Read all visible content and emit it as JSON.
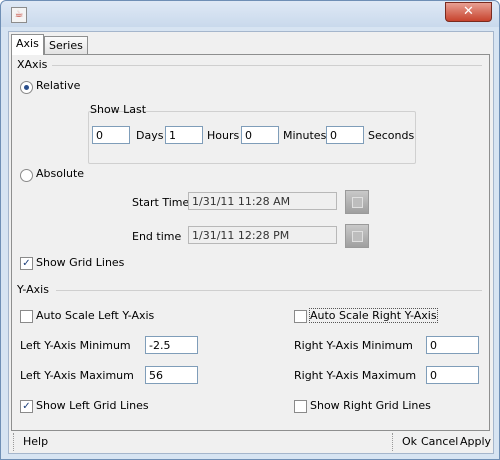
{
  "window": {
    "close_label": "✕"
  },
  "tabs": [
    {
      "label": "Axis"
    },
    {
      "label": "Series"
    }
  ],
  "xaxis": {
    "section_title": "XAxis",
    "relative_label": "Relative",
    "relative_selected": true,
    "show_last": {
      "title": "Show Last",
      "days_value": "0",
      "days_label": "Days",
      "hours_value": "1",
      "hours_label": "Hours",
      "minutes_value": "0",
      "minutes_label": "Minutes",
      "seconds_value": "0",
      "seconds_label": "Seconds"
    },
    "absolute_label": "Absolute",
    "absolute_selected": false,
    "start_time_label": "Start Time",
    "start_time_value": "1/31/11 11:28 AM",
    "end_time_label": "End time",
    "end_time_value": "1/31/11 12:28 PM",
    "show_grid_lines_label": "Show Grid Lines",
    "show_grid_lines_checked": true
  },
  "yaxis": {
    "section_title": "Y-Axis",
    "auto_scale_left_label": "Auto Scale Left Y-Axis",
    "auto_scale_left_checked": false,
    "auto_scale_right_label": "Auto Scale Right Y-Axis",
    "auto_scale_right_checked": false,
    "left_min_label": "Left Y-Axis Minimum",
    "left_min_value": "-2.5",
    "left_max_label": "Left Y-Axis Maximum",
    "left_max_value": "56",
    "right_min_label": "Right Y-Axis Minimum",
    "right_min_value": "0",
    "right_max_label": "Right Y-Axis Maximum",
    "right_max_value": "0",
    "show_left_grid_label": "Show Left Grid Lines",
    "show_left_grid_checked": true,
    "show_right_grid_label": "Show Right Grid Lines",
    "show_right_grid_checked": false
  },
  "footer": {
    "help_label": "Help",
    "ok_label": "Ok",
    "cancel_label": "Cancel",
    "apply_label": "Apply"
  }
}
